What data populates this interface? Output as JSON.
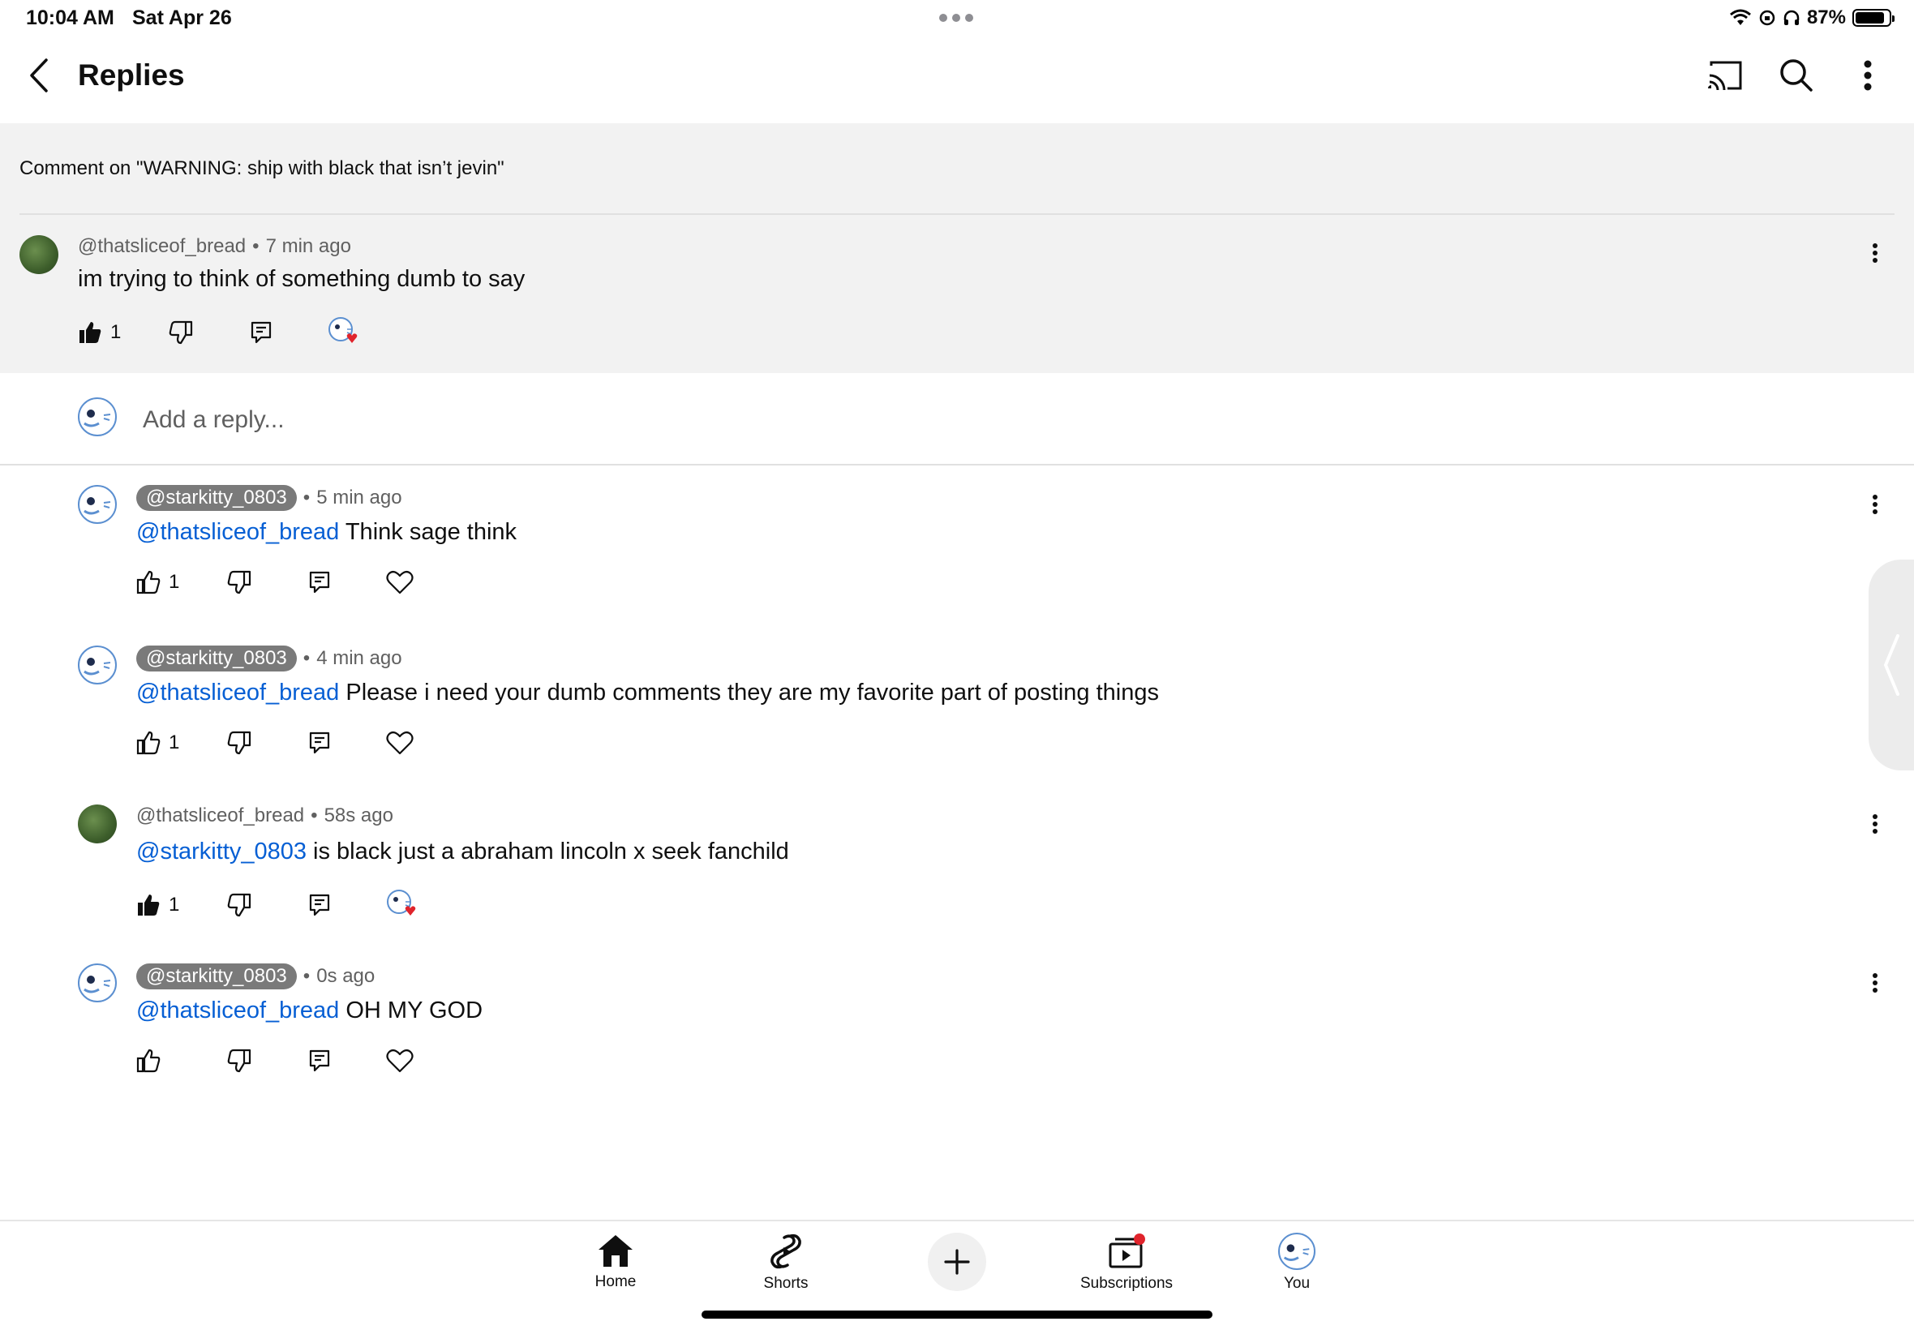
{
  "status_bar": {
    "time": "10:04 AM",
    "date": "Sat Apr 26",
    "battery_percent": "87%",
    "battery_level": 0.87
  },
  "header": {
    "title": "Replies",
    "icons": [
      "back-icon",
      "cast-icon",
      "search-icon",
      "more-vert-icon"
    ]
  },
  "parent": {
    "heading": "Comment on \"WARNING: ship with black that isn’t jevin\"",
    "author": "@thatsliceof_bread",
    "time": "7 min ago",
    "text": "im trying to think of something dumb to say",
    "likes": "1",
    "liked": true,
    "creator_hearted": true
  },
  "reply_box": {
    "placeholder": "Add a reply..."
  },
  "replies": [
    {
      "author": "@starkitty_0803",
      "time": "5 min ago",
      "mention": "@thatsliceof_bread",
      "text": " Think sage think",
      "likes": "1",
      "liked": false,
      "creator_hearted": false
    },
    {
      "author": "@starkitty_0803",
      "time": "4 min ago",
      "mention": "@thatsliceof_bread",
      "text": " Please i need your dumb comments they are my favorite part of posting things",
      "likes": "1",
      "liked": false,
      "creator_hearted": false
    },
    {
      "author": "@thatsliceof_bread",
      "time": "58s ago",
      "mention": "@starkitty_0803",
      "text": " is black just a abraham lincoln x seek fanchild",
      "likes": "1",
      "liked": true,
      "creator_hearted": true
    },
    {
      "author": "@starkitty_0803",
      "time": "0s ago",
      "mention": "@thatsliceof_bread",
      "text": " OH MY GOD",
      "likes": "",
      "liked": false,
      "creator_hearted": false
    }
  ],
  "meta_separator": "•",
  "bottom_nav": {
    "home": "Home",
    "shorts": "Shorts",
    "subscriptions": "Subscriptions",
    "you": "You"
  },
  "colors": {
    "mention": "#065fd4",
    "parent_bg": "#f2f2f2",
    "heart": "#e0242c",
    "chip": "#7a7a7a"
  }
}
